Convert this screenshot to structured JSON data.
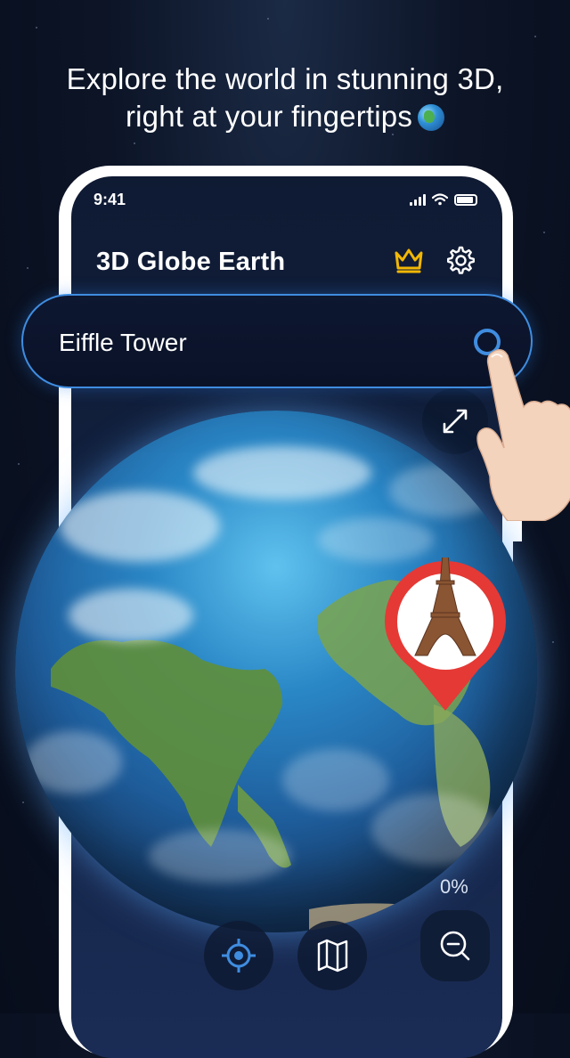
{
  "headline": {
    "line1": "Explore the world in stunning 3D,",
    "line2": "right at your fingertips",
    "emoji_icon": "globe-emoji"
  },
  "status_bar": {
    "time": "9:41",
    "icons": [
      "signal-icon",
      "wifi-icon",
      "battery-icon"
    ]
  },
  "app": {
    "title": "3D Globe Earth",
    "premium_icon": "crown-icon",
    "settings_icon": "gear-icon"
  },
  "search": {
    "value": "Eiffle Tower",
    "icon": "search-icon"
  },
  "controls": {
    "expand_icon": "expand-icon",
    "zoom_partial_text": "0%",
    "bottom_icons": [
      "location-target-icon",
      "map-icon",
      "zoom-out-icon"
    ]
  },
  "colors": {
    "accent": "#3f8de0",
    "crown": "#f2b705",
    "pin_red": "#e53935",
    "background": "#0c1426"
  }
}
